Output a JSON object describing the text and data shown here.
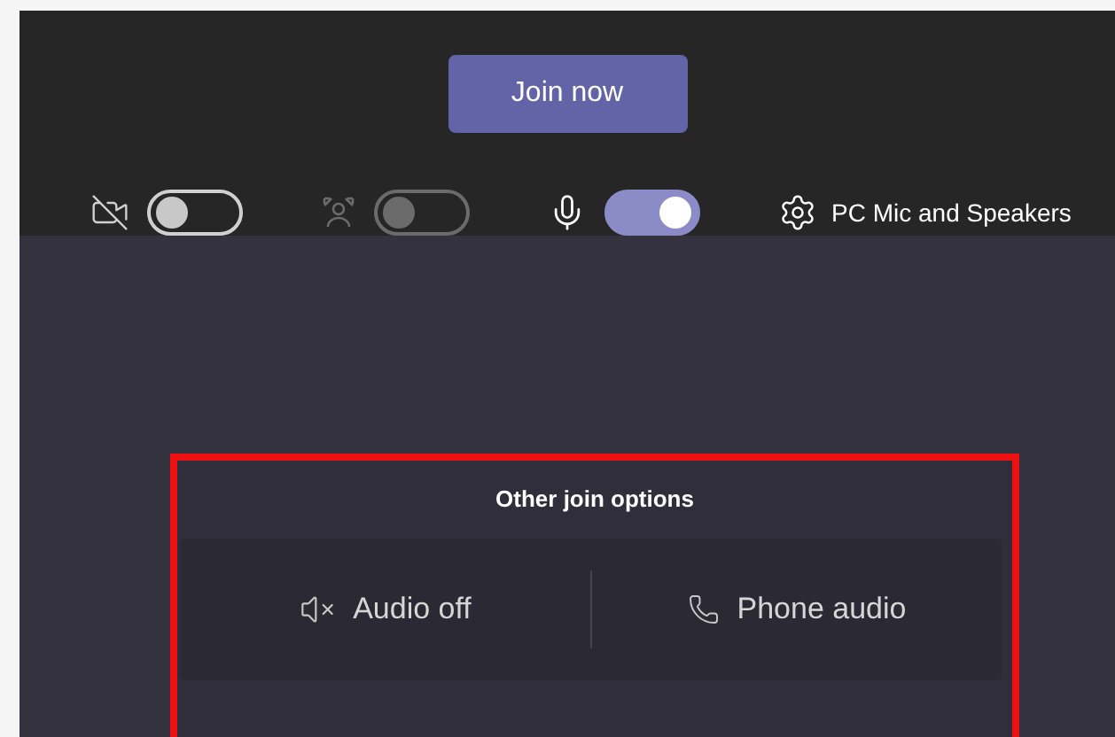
{
  "join_button": {
    "label": "Join now"
  },
  "controls": [
    {
      "kind": "camera",
      "on": false,
      "disabled": false
    },
    {
      "kind": "background",
      "on": false,
      "disabled": true
    },
    {
      "kind": "microphone",
      "on": true,
      "disabled": false
    }
  ],
  "device_settings": {
    "label": "PC Mic and Speakers"
  },
  "other_options": {
    "title": "Other join options",
    "highlighted": true,
    "options": [
      {
        "kind": "audio-off",
        "label": "Audio off"
      },
      {
        "kind": "phone",
        "label": "Phone audio"
      }
    ]
  }
}
